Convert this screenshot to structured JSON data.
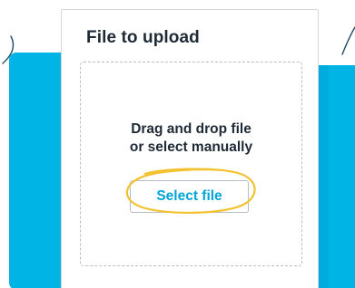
{
  "upload": {
    "title": "File to upload",
    "instructions_line1": "Drag and drop file",
    "instructions_line2": "or select manually",
    "select_button_label": "Select file"
  },
  "colors": {
    "accent_blue": "#00b4e6",
    "button_text": "#00a4d9",
    "highlight_circle": "#f2c230",
    "text_dark": "#1e2a35"
  },
  "icons": [
    "highlight-circle-icon",
    "decorative-swoosh-icon"
  ]
}
